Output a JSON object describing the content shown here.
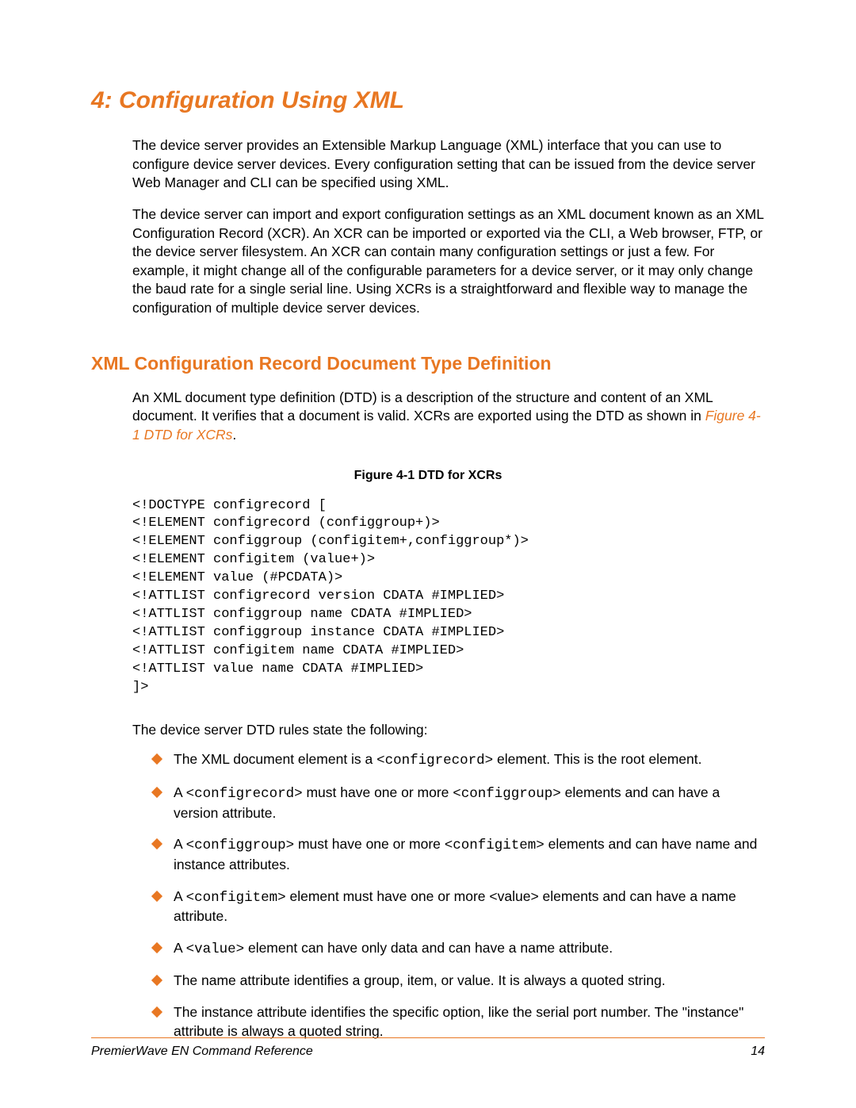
{
  "chapter": {
    "title": "4:   Configuration Using XML"
  },
  "paragraphs": {
    "p1": "The device server provides an Extensible Markup Language (XML) interface that you can use to configure device server devices. Every configuration setting that can be issued from the device server Web Manager and CLI can be specified using XML.",
    "p2": "The device server can import and export configuration settings as an XML document known as an XML Configuration Record (XCR). An XCR can be imported or exported via the CLI, a Web browser, FTP, or the device server filesystem. An XCR can contain many configuration settings or just a few. For example, it might change all of the configurable parameters for a device server, or it may only change the baud rate for a single serial line. Using XCRs is a straightforward and flexible way to manage the configuration of multiple device server devices."
  },
  "section": {
    "title": "XML Configuration Record Document Type Definition",
    "intro_a": "An XML document type definition (DTD) is a description of the structure and content of an XML document. It verifies that a document is valid. XCRs are exported using the DTD as shown in ",
    "intro_link": "Figure 4-1 DTD for XCRs",
    "intro_b": "."
  },
  "figure": {
    "caption": "Figure 4-1  DTD for XCRs",
    "code": "<!DOCTYPE configrecord [\n<!ELEMENT configrecord (configgroup+)>\n<!ELEMENT configgroup (configitem+,configgroup*)>\n<!ELEMENT configitem (value+)>\n<!ELEMENT value (#PCDATA)>\n<!ATTLIST configrecord version CDATA #IMPLIED>\n<!ATTLIST configgroup name CDATA #IMPLIED>\n<!ATTLIST configgroup instance CDATA #IMPLIED>\n<!ATTLIST configitem name CDATA #IMPLIED>\n<!ATTLIST value name CDATA #IMPLIED>\n]>"
  },
  "rules_intro": "The device server DTD rules state the following:",
  "bullets": {
    "b1a": "The XML document element is a ",
    "b1code": "<configrecord>",
    "b1b": " element. This is the root element.",
    "b2a": "A ",
    "b2code1": "<configrecord>",
    "b2b": " must have one or more ",
    "b2code2": "<configgroup>",
    "b2c": " elements and can have a version attribute.",
    "b3a": "A ",
    "b3code1": "<configgroup>",
    "b3b": " must have one or more ",
    "b3code2": "<configitem>",
    "b3c": " elements and can have name and instance attributes.",
    "b4a": "A ",
    "b4code": "<configitem>",
    "b4b": " element must have one or more <value> elements and can have a name attribute.",
    "b5a": "A ",
    "b5code": "<value>",
    "b5b": " element can have only data and can have a name attribute.",
    "b6": "The name attribute identifies a group, item, or value. It is always a quoted string.",
    "b7": "The instance attribute identifies the specific option, like the serial port number. The \"instance\" attribute is always a quoted string."
  },
  "footer": {
    "left": "PremierWave EN Command Reference",
    "right": "14"
  }
}
